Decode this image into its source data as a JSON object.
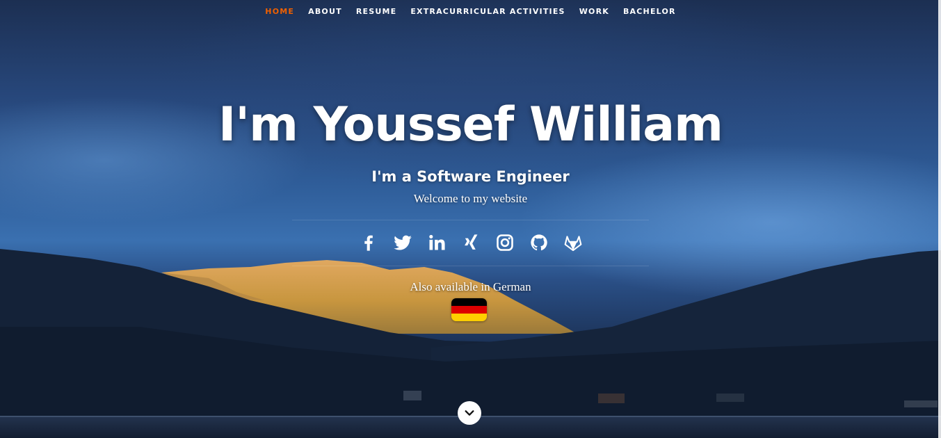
{
  "nav": {
    "items": [
      {
        "label": "HOME",
        "active": true
      },
      {
        "label": "ABOUT",
        "active": false
      },
      {
        "label": "RESUME",
        "active": false
      },
      {
        "label": "EXTRACURRICULAR ACTIVITIES",
        "active": false
      },
      {
        "label": "WORK",
        "active": false
      },
      {
        "label": "BACHELOR",
        "active": false
      }
    ],
    "active_color": "#f06000"
  },
  "banner": {
    "title": "I'm Youssef William",
    "subtitle": "I'm a Software Engineer",
    "welcome": "Welcome to my website"
  },
  "social": [
    {
      "icon": "facebook-icon"
    },
    {
      "icon": "twitter-icon"
    },
    {
      "icon": "linkedin-icon"
    },
    {
      "icon": "xing-icon"
    },
    {
      "icon": "instagram-icon"
    },
    {
      "icon": "github-icon"
    },
    {
      "icon": "gitlab-icon"
    }
  ],
  "language": {
    "text": "Also available in German",
    "flag_icon": "german-flag-icon",
    "flag_colors": [
      "#000000",
      "#dd0000",
      "#ffce00"
    ]
  },
  "scroll_icon": "chevron-down-icon"
}
